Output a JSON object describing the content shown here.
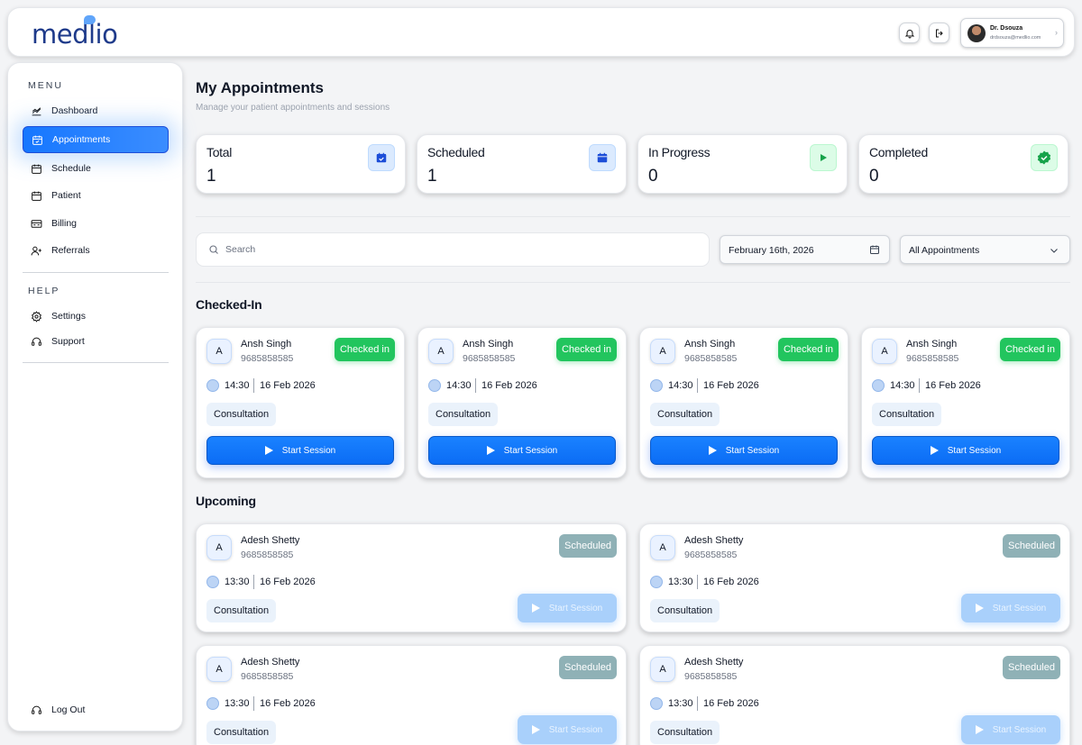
{
  "header": {
    "logo": "medlio",
    "user_name": "Dr. Dsouza",
    "user_email": "drdsouza@medlio.com"
  },
  "sidebar": {
    "menu_title": "MENU",
    "items": [
      {
        "label": "Dashboard"
      },
      {
        "label": "Appointments"
      },
      {
        "label": "Schedule"
      },
      {
        "label": "Patient"
      },
      {
        "label": "Billing"
      },
      {
        "label": "Referrals"
      }
    ],
    "help_title": "HELP",
    "help_items": [
      {
        "label": "Settings"
      },
      {
        "label": "Support"
      }
    ],
    "logout": "Log Out"
  },
  "main": {
    "title": "My Appointments",
    "subtitle": "Manage your patient appointments and sessions",
    "stats": [
      {
        "label": "Total",
        "value": "1"
      },
      {
        "label": "Scheduled",
        "value": "1"
      },
      {
        "label": "In Progress",
        "value": "0"
      },
      {
        "label": "Completed",
        "value": "0"
      }
    ],
    "search_placeholder": "Search",
    "date_filter": "February 16th, 2026",
    "type_filter": "All Appointments",
    "checked_in_title": "Checked-In",
    "upcoming_title": "Upcoming",
    "checked_in": [
      {
        "initial": "A",
        "name": "Ansh Singh",
        "phone": "9685858585",
        "status": "Checked in",
        "time": "14:30",
        "date": "16 Feb 2026",
        "type": "Consultation",
        "action": "Start Session"
      },
      {
        "initial": "A",
        "name": "Ansh Singh",
        "phone": "9685858585",
        "status": "Checked in",
        "time": "14:30",
        "date": "16 Feb 2026",
        "type": "Consultation",
        "action": "Start Session"
      },
      {
        "initial": "A",
        "name": "Ansh Singh",
        "phone": "9685858585",
        "status": "Checked in",
        "time": "14:30",
        "date": "16 Feb 2026",
        "type": "Consultation",
        "action": "Start Session"
      },
      {
        "initial": "A",
        "name": "Ansh Singh",
        "phone": "9685858585",
        "status": "Checked in",
        "time": "14:30",
        "date": "16 Feb 2026",
        "type": "Consultation",
        "action": "Start Session"
      }
    ],
    "upcoming": [
      {
        "initial": "A",
        "name": "Adesh Shetty",
        "phone": "9685858585",
        "status": "Scheduled",
        "time": "13:30",
        "date": "16 Feb 2026",
        "type": "Consultation",
        "action": "Start Session"
      },
      {
        "initial": "A",
        "name": "Adesh Shetty",
        "phone": "9685858585",
        "status": "Scheduled",
        "time": "13:30",
        "date": "16 Feb 2026",
        "type": "Consultation",
        "action": "Start Session"
      },
      {
        "initial": "A",
        "name": "Adesh Shetty",
        "phone": "9685858585",
        "status": "Scheduled",
        "time": "13:30",
        "date": "16 Feb 2026",
        "type": "Consultation",
        "action": "Start Session"
      },
      {
        "initial": "A",
        "name": "Adesh Shetty",
        "phone": "9685858585",
        "status": "Scheduled",
        "time": "13:30",
        "date": "16 Feb 2026",
        "type": "Consultation",
        "action": "Start Session"
      }
    ]
  },
  "colors": {
    "accent": "#1677ff",
    "checked_in_badge": "#22c55e",
    "scheduled_badge": "#8fb1b6"
  },
  "icons": {
    "header": [
      "bell-icon",
      "logout-icon",
      "chevron-right-icon"
    ],
    "sidebar": [
      "chart-icon",
      "calendar-check-icon",
      "calendar-icon",
      "calendar-icon",
      "billing-icon",
      "user-plus-icon",
      "gear-icon",
      "headset-icon",
      "headset-icon"
    ],
    "stats": [
      "calendar-check-icon",
      "calendar-icon",
      "play-icon",
      "verified-icon"
    ]
  }
}
